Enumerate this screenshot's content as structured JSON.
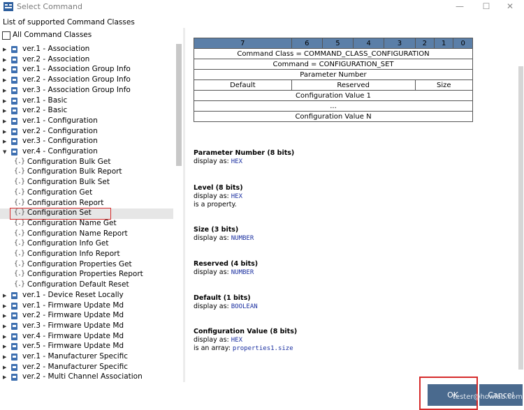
{
  "window": {
    "title": "Select Command",
    "minimize": "—",
    "maximize": "☐",
    "close": "✕"
  },
  "header_label": "List of supported Command Classes",
  "all_classes_label": "All Command Classes",
  "tree": [
    {
      "label": "ver.1 - Association",
      "type": "node"
    },
    {
      "label": "ver.2 - Association",
      "type": "node"
    },
    {
      "label": "ver.1 - Association Group Info",
      "type": "node"
    },
    {
      "label": "ver.2 - Association Group Info",
      "type": "node"
    },
    {
      "label": "ver.3 - Association Group Info",
      "type": "node"
    },
    {
      "label": "ver.1 - Basic",
      "type": "node"
    },
    {
      "label": "ver.2 - Basic",
      "type": "node"
    },
    {
      "label": "ver.1 - Configuration",
      "type": "node"
    },
    {
      "label": "ver.2 - Configuration",
      "type": "node"
    },
    {
      "label": "ver.3 - Configuration",
      "type": "node"
    },
    {
      "label": "ver.4 - Configuration",
      "type": "node",
      "expanded": true
    },
    {
      "label": "Configuration Bulk Get",
      "type": "leaf"
    },
    {
      "label": "Configuration Bulk Report",
      "type": "leaf"
    },
    {
      "label": "Configuration Bulk Set",
      "type": "leaf"
    },
    {
      "label": "Configuration Get",
      "type": "leaf"
    },
    {
      "label": "Configuration Report",
      "type": "leaf"
    },
    {
      "label": "Configuration Set",
      "type": "leaf",
      "selected": true
    },
    {
      "label": "Configuration Name Get",
      "type": "leaf"
    },
    {
      "label": "Configuration Name Report",
      "type": "leaf"
    },
    {
      "label": "Configuration Info Get",
      "type": "leaf"
    },
    {
      "label": "Configuration Info Report",
      "type": "leaf"
    },
    {
      "label": "Configuration Properties Get",
      "type": "leaf"
    },
    {
      "label": "Configuration Properties Report",
      "type": "leaf"
    },
    {
      "label": "Configuration Default Reset",
      "type": "leaf"
    },
    {
      "label": "ver.1 - Device Reset Locally",
      "type": "node"
    },
    {
      "label": "ver.1 - Firmware Update Md",
      "type": "node"
    },
    {
      "label": "ver.2 - Firmware Update Md",
      "type": "node"
    },
    {
      "label": "ver.3 - Firmware Update Md",
      "type": "node"
    },
    {
      "label": "ver.4 - Firmware Update Md",
      "type": "node"
    },
    {
      "label": "ver.5 - Firmware Update Md",
      "type": "node"
    },
    {
      "label": "ver.1 - Manufacturer Specific",
      "type": "node"
    },
    {
      "label": "ver.2 - Manufacturer Specific",
      "type": "node"
    },
    {
      "label": "ver.2 - Multi Channel Association",
      "type": "node"
    }
  ],
  "table": {
    "bits": [
      "7",
      "6",
      "5",
      "4",
      "3",
      "2",
      "1",
      "0"
    ],
    "command_class": "Command Class = COMMAND_CLASS_CONFIGURATION",
    "command": "Command = CONFIGURATION_SET",
    "parameter_number": "Parameter Number",
    "default": "Default",
    "reserved": "Reserved",
    "size": "Size",
    "value1": "Configuration Value 1",
    "ellipsis": "...",
    "valueN": "Configuration Value N"
  },
  "descriptions": [
    {
      "title": "Parameter Number (8 bits)",
      "display_prefix": "display as: ",
      "display": "HEX",
      "extra_prefix": "",
      "extra": ""
    },
    {
      "title": "Level (8 bits)",
      "display_prefix": "display as: ",
      "display": "HEX",
      "extra_prefix": "is a property.",
      "extra": ""
    },
    {
      "title": "Size (3 bits)",
      "display_prefix": "display as: ",
      "display": "NUMBER",
      "extra_prefix": "",
      "extra": ""
    },
    {
      "title": "Reserved (4 bits)",
      "display_prefix": "display as: ",
      "display": "NUMBER",
      "extra_prefix": "",
      "extra": ""
    },
    {
      "title": "Default (1 bits)",
      "display_prefix": "display as: ",
      "display": "BOOLEAN",
      "extra_prefix": "",
      "extra": ""
    },
    {
      "title": "Configuration Value (8 bits)",
      "display_prefix": "display as: ",
      "display": "HEX",
      "extra_prefix": "is an array: ",
      "extra": "properties1.size"
    }
  ],
  "buttons": {
    "ok": "OK",
    "cancel": "Cancel"
  },
  "watermark": "tester@howlab.com",
  "colors": {
    "accent": "#4a6a8e",
    "highlight": "#d62a2a",
    "bit_header": "#5b7fa8",
    "mono_text": "#1a2fa0"
  }
}
